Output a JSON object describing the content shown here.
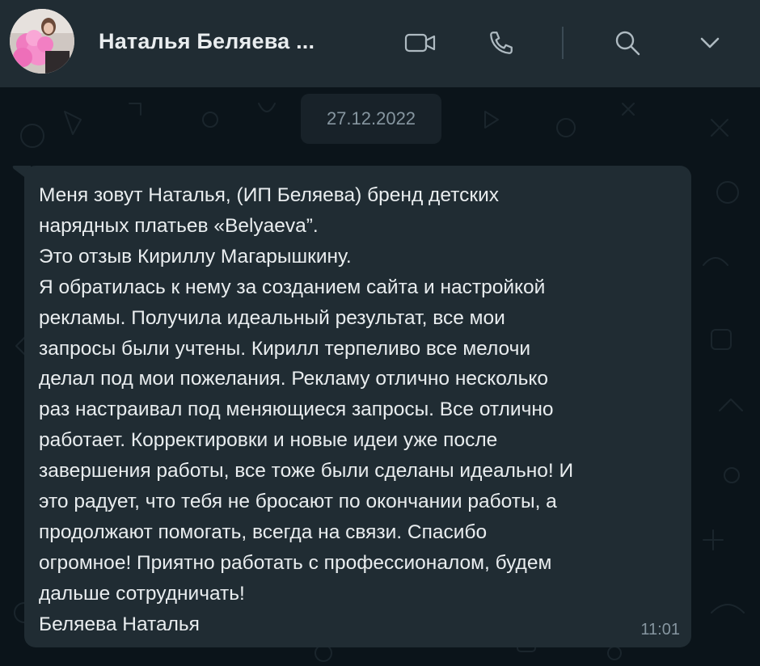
{
  "header": {
    "contact_name": "Наталья Беляева ...",
    "icons": [
      "video-call-icon",
      "phone-call-icon",
      "search-icon",
      "chevron-down-icon"
    ]
  },
  "chat": {
    "date_separator": "27.12.2022",
    "message": {
      "text": "Меня зовут Наталья, (ИП Беляева) бренд детских\nнарядных платьев «Belyaeva”.\nЭто отзыв Кириллу Магарышкину.\nЯ обратилась к нему за созданием сайта и настройкой\nрекламы. Получила идеальный результат, все мои\nзапросы были учтены. Кирилл терпеливо все мелочи\nделал под мои пожелания. Рекламу отлично несколько\nраз настраивал под меняющиеся запросы. Все отлично\nработает. Корректировки и новые идеи уже после\nзавершения работы, все тоже были сделаны идеально! И\nэто радует, что тебя не бросают по окончании работы, а\nпродолжают помогать, всегда на связи. Спасибо\nогромное! Приятно работать с профессионалом, будем\nдальше сотрудничать!\nБеляева Наталья",
      "time": "11:01"
    }
  },
  "colors": {
    "background": "#0b141a",
    "header": "#202c33",
    "bubble": "#202c33",
    "text_primary": "#e9edef",
    "text_secondary": "#8696a0"
  }
}
